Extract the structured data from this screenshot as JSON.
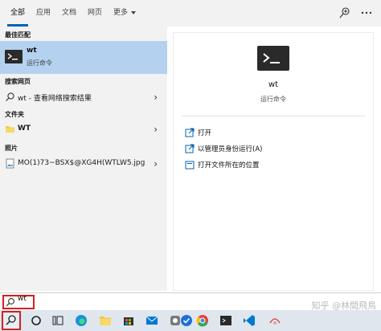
{
  "tabs": {
    "all": "全部",
    "apps": "应用",
    "docs": "文档",
    "web": "网页",
    "more": "更多"
  },
  "left": {
    "best_match_header": "最佳匹配",
    "best_match": {
      "title": "wt",
      "subtitle": "运行命令"
    },
    "web_header": "搜索网页",
    "web_item": "wt - 查看网络搜索结果",
    "folders_header": "文件夹",
    "folder_item": "WT",
    "photos_header": "照片",
    "photo_item": "MO(1)73~BSX$@XG4H(WTLW5.jpg"
  },
  "right": {
    "title": "wt",
    "subtitle": "运行命令",
    "actions": [
      "打开",
      "以管理员身份运行(A)",
      "打开文件所在的位置"
    ]
  },
  "search": {
    "value": "wt"
  },
  "watermark": "知乎 @林間飛鳥",
  "icons": {
    "feedback": "feedback-icon",
    "more": "more-options-icon",
    "search": "search-icon",
    "terminal": "terminal-icon",
    "folder": "folder-icon",
    "image": "image-file-icon"
  },
  "colors": {
    "accent": "#0063b1",
    "selected": "#b4d2ef",
    "highlight_box": "#d32020",
    "pane_bg": "#f2f2f2"
  }
}
